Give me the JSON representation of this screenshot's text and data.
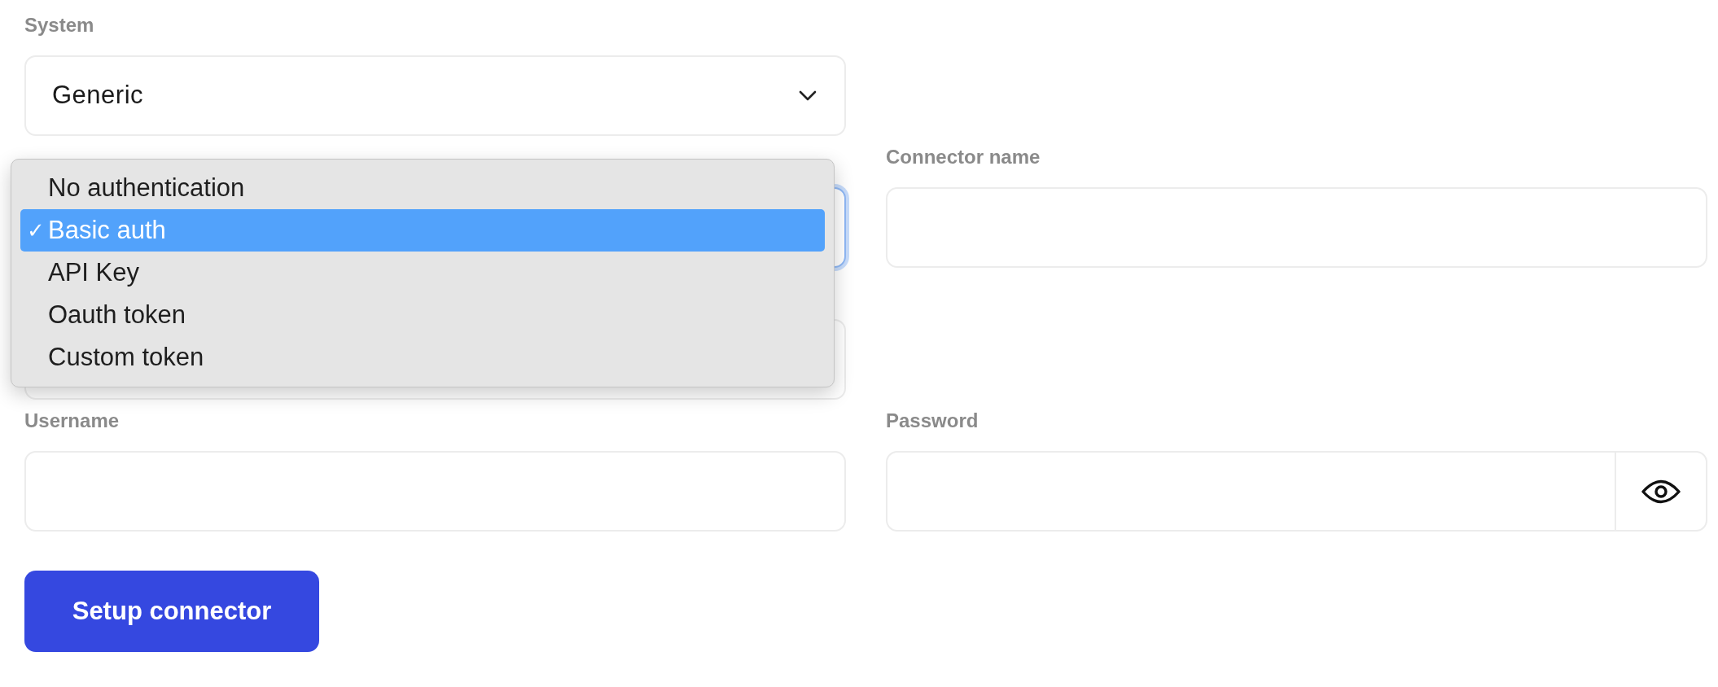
{
  "system": {
    "label": "System",
    "value": "Generic"
  },
  "connector_type": {
    "focused": true,
    "menu": {
      "check": "✓",
      "options": [
        {
          "label": "No authentication",
          "selected": false
        },
        {
          "label": "Basic auth",
          "selected": true
        },
        {
          "label": "API Key",
          "selected": false
        },
        {
          "label": "Oauth token",
          "selected": false
        },
        {
          "label": "Custom token",
          "selected": false
        }
      ]
    }
  },
  "connector_name": {
    "label": "Connector name"
  },
  "username": {
    "label": "Username"
  },
  "password": {
    "label": "Password"
  },
  "submit_button": "Setup connector"
}
